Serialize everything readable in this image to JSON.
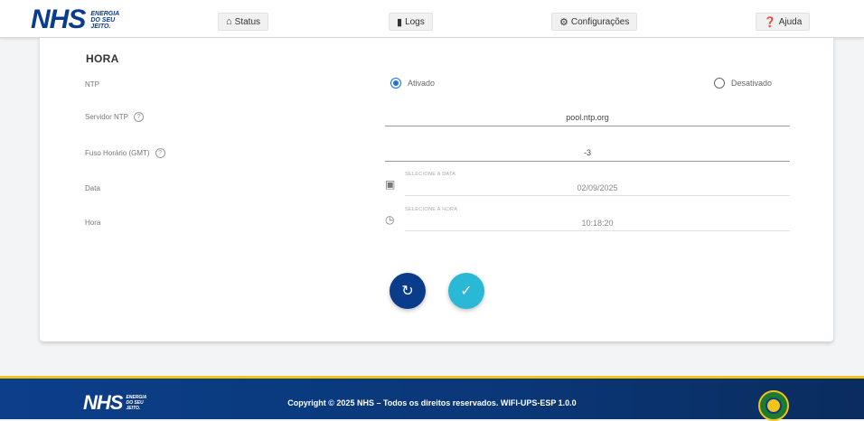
{
  "header": {
    "logo_main": "NHS",
    "logo_sub": [
      "ENERGIA",
      "DO SEU",
      "JEITO."
    ],
    "nav": [
      {
        "label": "Status",
        "icon": "home-icon"
      },
      {
        "label": "Logs",
        "icon": "file-icon"
      },
      {
        "label": "Configurações",
        "icon": "gears-icon"
      },
      {
        "label": "Ajuda",
        "icon": "question-circle-icon"
      }
    ]
  },
  "form": {
    "section_title": "HORA",
    "ntp": {
      "label": "NTP",
      "options": [
        {
          "label": "Ativado",
          "selected": true
        },
        {
          "label": "Desativado",
          "selected": false
        }
      ]
    },
    "ntp_server": {
      "label": "Servidor NTP",
      "value": "pool.ntp.org"
    },
    "timezone": {
      "label": "Fuso Horário (GMT)",
      "value": "-3"
    },
    "date": {
      "label": "Data",
      "picker_label": "SELECIONE A DATA",
      "value": "02/09/2025"
    },
    "time": {
      "label": "Hora",
      "picker_label": "SELECIONE A HORA",
      "value": "10:18:20"
    },
    "buttons": {
      "reset": {
        "icon": "refresh-icon",
        "color": "#0a3c8c"
      },
      "apply": {
        "icon": "check-icon",
        "color": "#29b8d6"
      }
    }
  },
  "footer": {
    "logo_main": "NHS",
    "logo_sub": [
      "ENERGIA",
      "DO SEU",
      "JEITO."
    ],
    "copyright": "Copyright © 2025 NHS – Todos os direitos reservados. WIFI-UPS-ESP 1.0.0"
  },
  "colors": {
    "brand_blue": "#0a3c8c",
    "accent_cyan": "#29b8d6",
    "footer_stripe": "#f2c318",
    "radio_selected": "#1a73e8"
  }
}
